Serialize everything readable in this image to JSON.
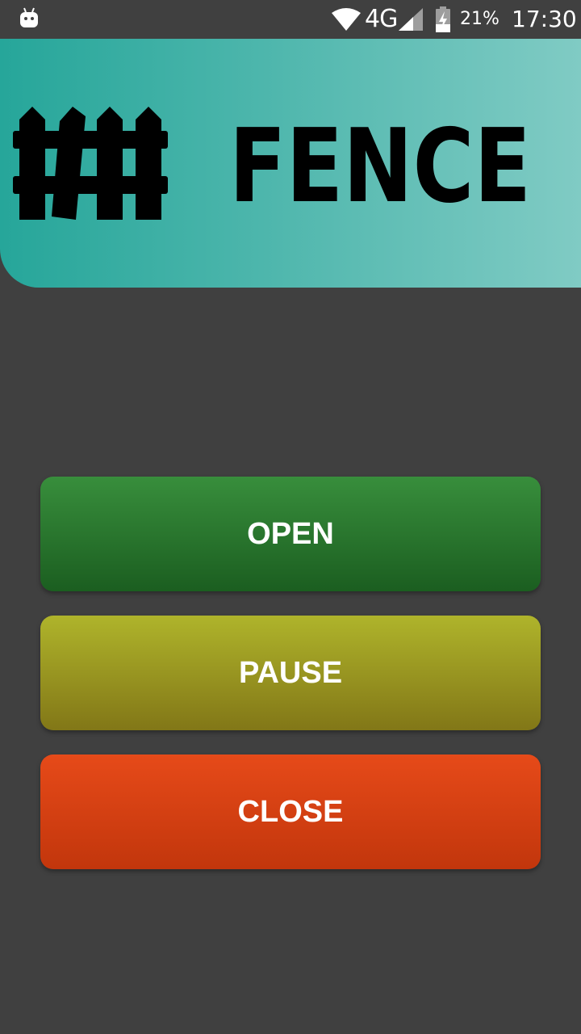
{
  "status_bar": {
    "network": "4G",
    "battery": "21%",
    "time": "17:30",
    "icons": [
      "android-debug-icon",
      "wifi-icon",
      "signal-icon",
      "battery-charging-icon"
    ]
  },
  "header": {
    "title": "FENCE",
    "logo_icon": "fence-icon",
    "gradient_colors": [
      "#26a69a",
      "#80cbc4"
    ]
  },
  "controls": {
    "open": {
      "label": "OPEN",
      "color": "#2e7d32"
    },
    "pause": {
      "label": "PAUSE",
      "color": "#9e9d24"
    },
    "close": {
      "label": "CLOSE",
      "color": "#d84315"
    }
  },
  "background_color": "#404040"
}
